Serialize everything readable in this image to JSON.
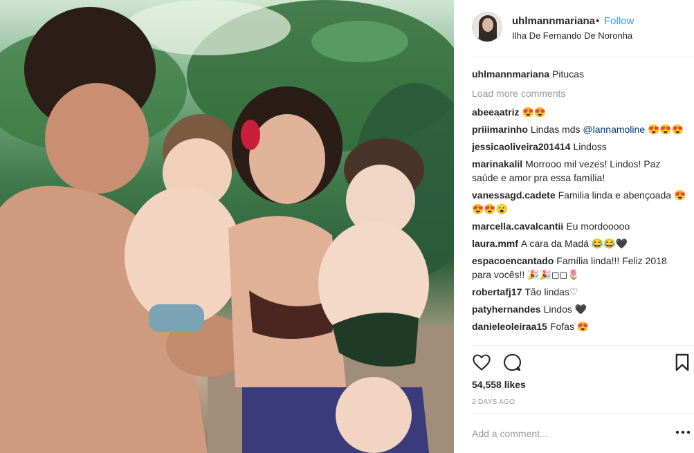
{
  "post": {
    "username": "uhlmannmariana",
    "separator": "•",
    "follow_label": "Follow",
    "location": "Ilha De Fernando De Noronha",
    "caption": "Pitucas",
    "load_more": "Load more comments",
    "likes": "54,558 likes",
    "time": "2 DAYS AGO",
    "add_comment_placeholder": "Add a comment..."
  },
  "comments": [
    {
      "user": "abeeaatriz",
      "text": "😍😍"
    },
    {
      "user": "priiimarinho",
      "text": "Lindas mds ",
      "mention": "@lannamoline",
      "text_after": " 😍😍😍"
    },
    {
      "user": "jessicaoliveira201414",
      "text": "Lindoss"
    },
    {
      "user": "marinakalil",
      "text": "Morrooo mil vezes! Lindos! Paz saúde e amor pra essa família!"
    },
    {
      "user": "vanessagd.cadete",
      "text": "Familia linda e abençoada 😍😍😍😮"
    },
    {
      "user": "marcella.cavalcantii",
      "text": "Eu mordooooo"
    },
    {
      "user": "laura.mmf",
      "text": "A cara da Madá 😂😂🖤"
    },
    {
      "user": "espacoencantado",
      "text": "Família linda!!! Feliz 2018 para vocês!! 🎉🎉◻◻🌷"
    },
    {
      "user": "robertafj17",
      "text": "Tão lindas♡"
    },
    {
      "user": "patyhernandes",
      "text": "Lindos 🖤"
    },
    {
      "user": "danieleoleiraa15",
      "text": "Fofas 😍"
    }
  ],
  "icons": {
    "like": "heart-icon",
    "comment": "speech-bubble-icon",
    "save": "bookmark-icon",
    "options": "more-options-icon"
  },
  "colors": {
    "link": "#3897f0",
    "text": "#262626",
    "muted": "#999999",
    "divider": "#efefef"
  }
}
